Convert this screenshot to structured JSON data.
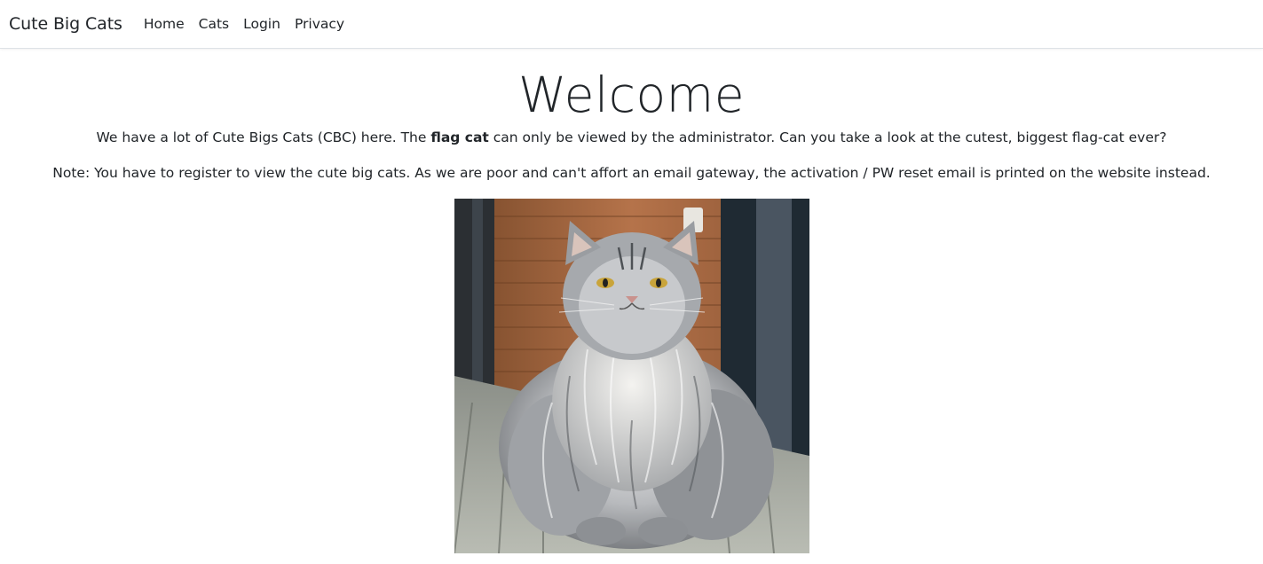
{
  "navbar": {
    "brand": "Cute Big Cats",
    "links": [
      "Home",
      "Cats",
      "Login",
      "Privacy"
    ]
  },
  "main": {
    "title": "Welcome",
    "intro_before": "We have a lot of Cute Bigs Cats (CBC) here. The ",
    "intro_bold": "flag cat",
    "intro_after": " can only be viewed by the administrator. Can you take a look at the cutest, biggest flag-cat ever?",
    "note": "Note: You have to register to view the cute big cats. As we are poor and can't affort an email gateway, the activation / PW reset email is printed on the website instead."
  },
  "colors": {
    "text": "#212529",
    "border": "#dee2e6",
    "background": "#ffffff"
  }
}
